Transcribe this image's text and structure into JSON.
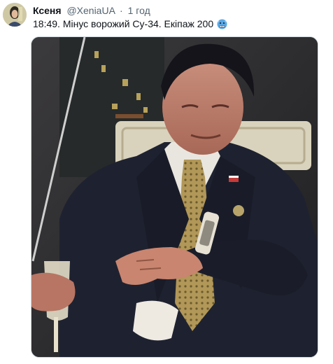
{
  "tweet": {
    "author_name": "Ксеня",
    "author_handle": "@XeniaUA",
    "separator": "·",
    "time_ago": "1 год",
    "text": "18:49. Мінус ворожий Су-34. Екіпаж 200",
    "emoji": "cold-face-emoji"
  },
  "media": {
    "icon": "photo-of-man-checking-wristwatch"
  },
  "colors": {
    "text_primary": "#0f1419",
    "text_secondary": "#536471",
    "border": "#cfd9de",
    "emoji_blue": "#5aa9e6"
  }
}
